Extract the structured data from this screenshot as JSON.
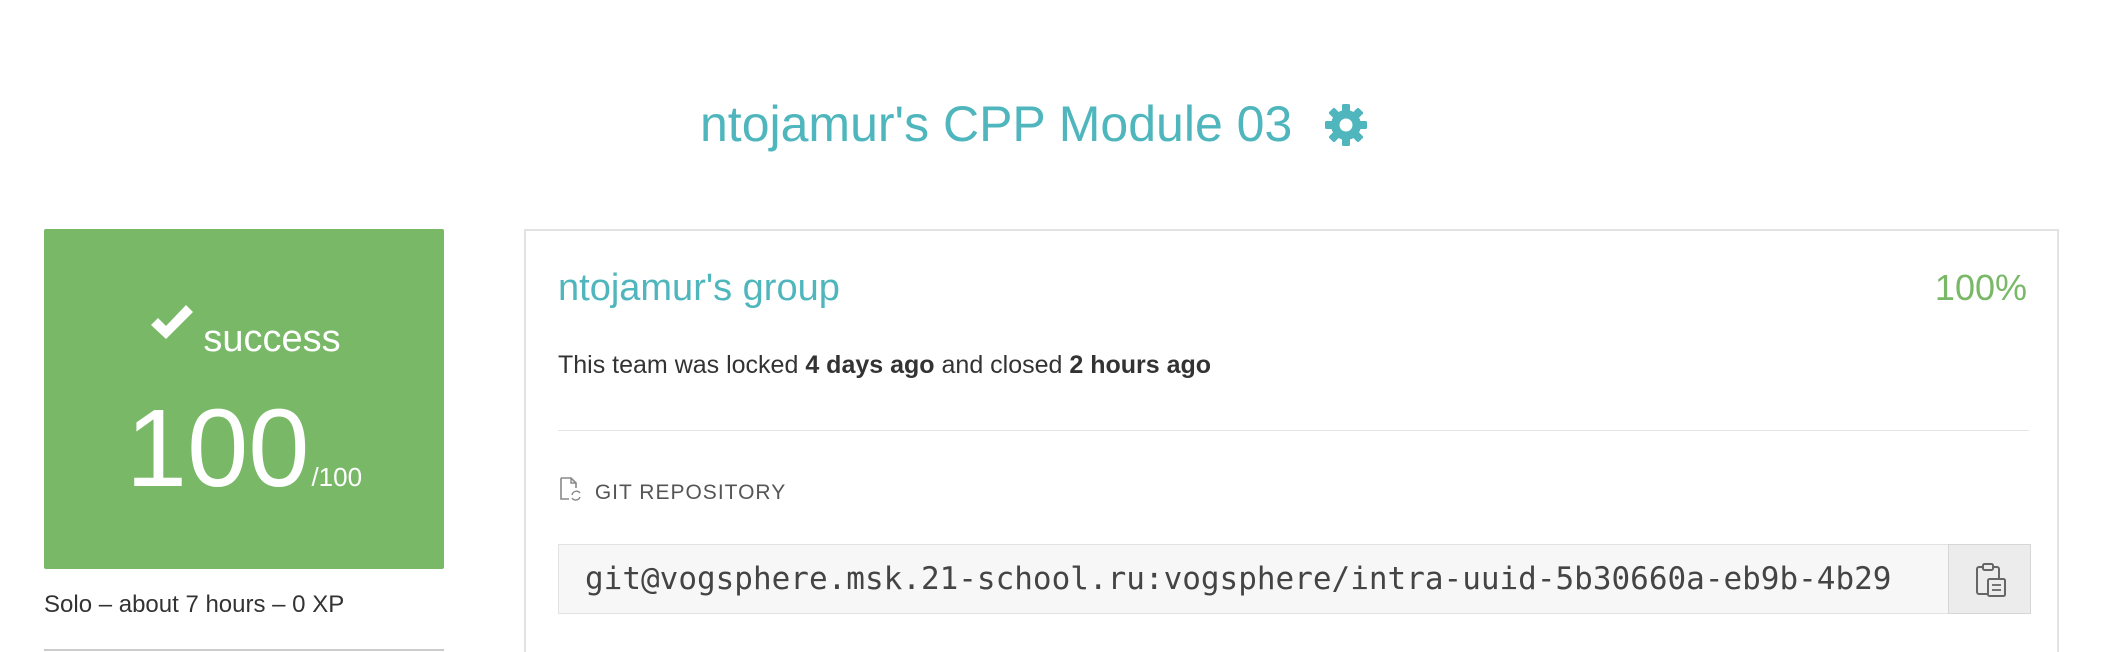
{
  "header": {
    "title": "ntojamur's CPP Module 03",
    "settings_icon": "gear-icon",
    "accent_color": "#4eb6bc"
  },
  "status_card": {
    "status_icon": "checkmark-icon",
    "status": "success",
    "score": "100",
    "score_max": "/100",
    "color": "#78b866"
  },
  "meta": {
    "text": "Solo – about 7 hours – 0 XP"
  },
  "team": {
    "name": "ntojamur's group",
    "percent": "100%",
    "lock_prefix": "This team was locked ",
    "locked_ago": "4 days ago",
    "lock_middle": " and closed ",
    "closed_ago": "2 hours ago",
    "repo_label": "GIT REPOSITORY",
    "repo_icon": "file-sync-icon",
    "repo_url": "git@vogsphere.msk.21-school.ru:vogsphere/intra-uuid-5b30660a-eb9b-4b29",
    "copy_icon": "clipboard-icon"
  }
}
